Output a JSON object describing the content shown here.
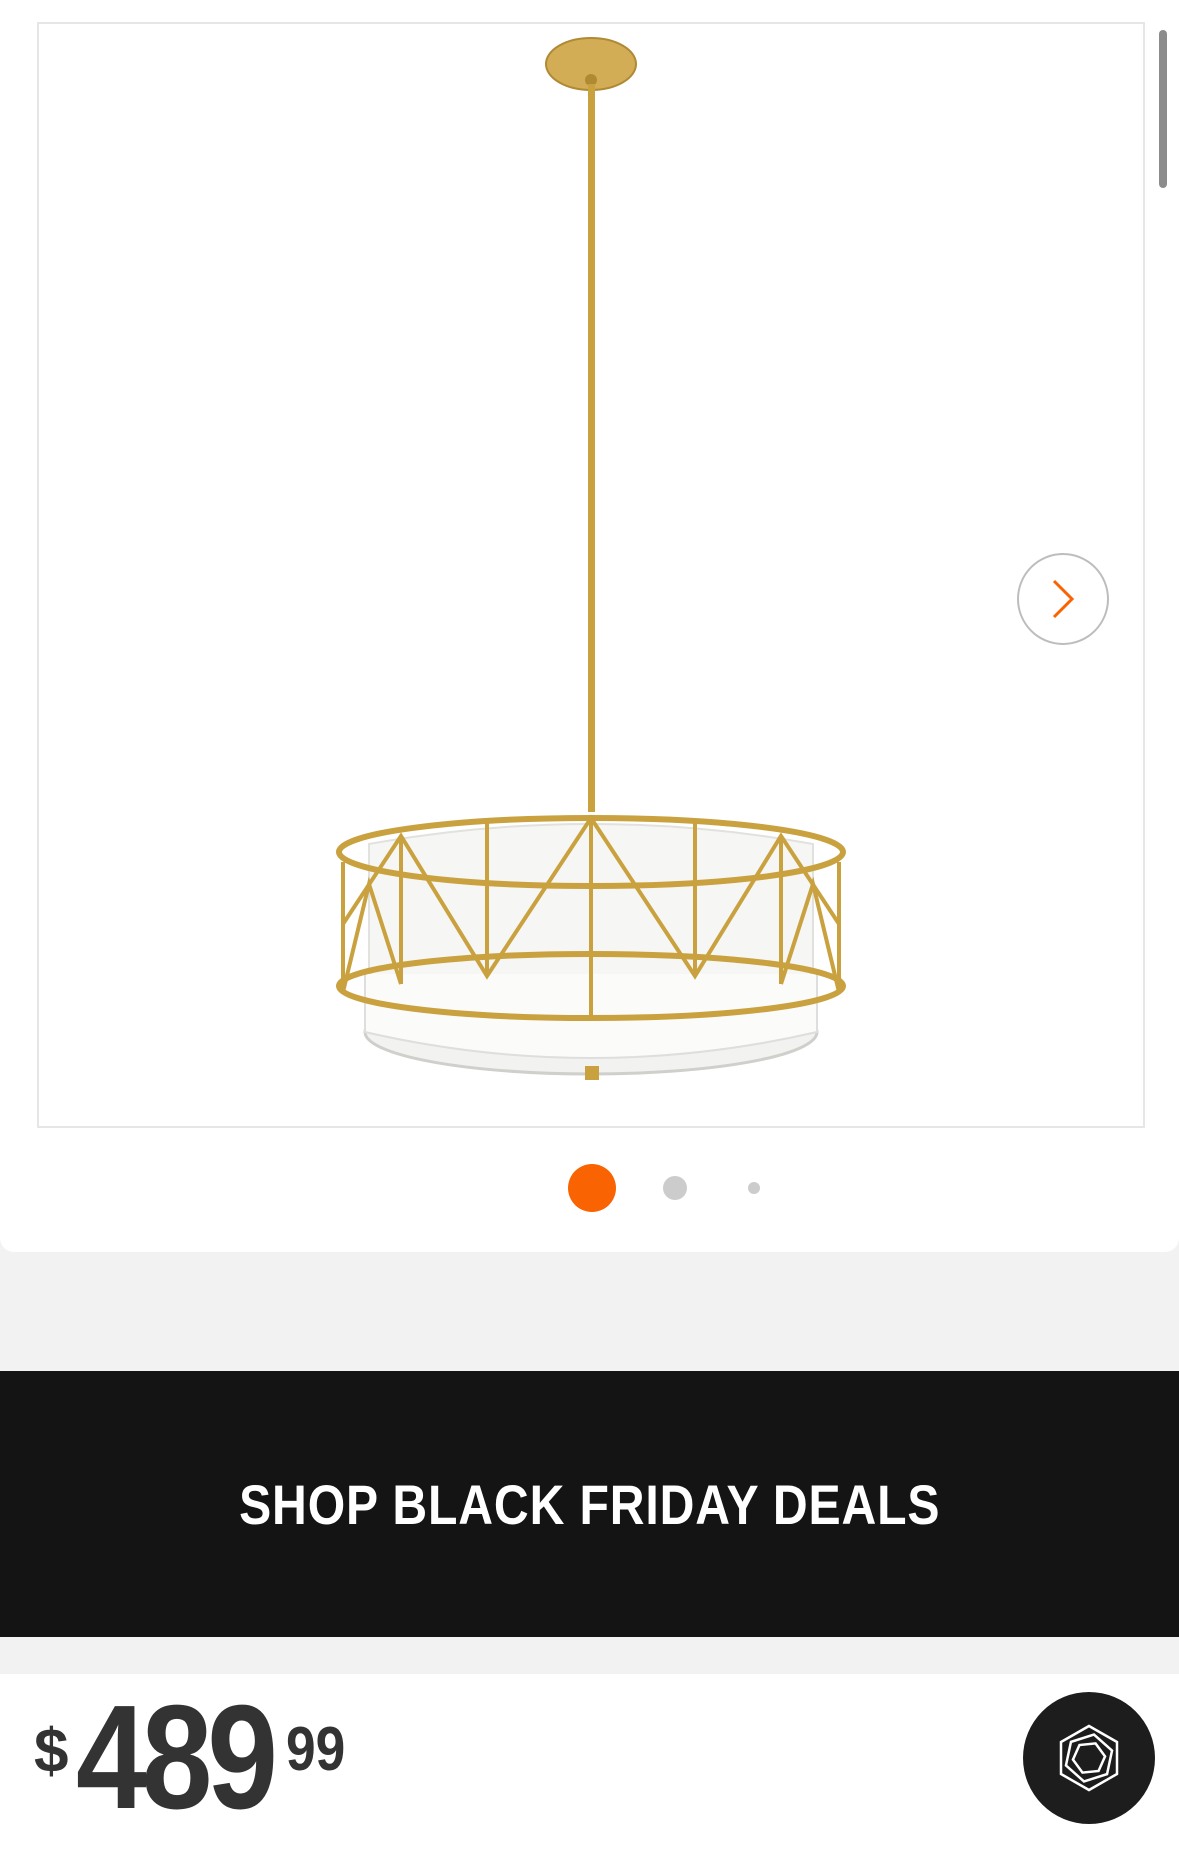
{
  "gallery": {
    "product_image": "Gold cage drum pendant light with white fabric shade",
    "next_icon": "chevron-right-icon",
    "slide_count": 3,
    "active_slide": 1
  },
  "promo": {
    "label": "SHOP BLACK FRIDAY DEALS"
  },
  "price": {
    "currency": "$",
    "dollars": "489",
    "cents": "99"
  },
  "chat": {
    "icon": "hexagon-chat-icon"
  },
  "colors": {
    "accent": "#f96302",
    "banner": "#141414",
    "frame_gold": "#c9a13f"
  }
}
